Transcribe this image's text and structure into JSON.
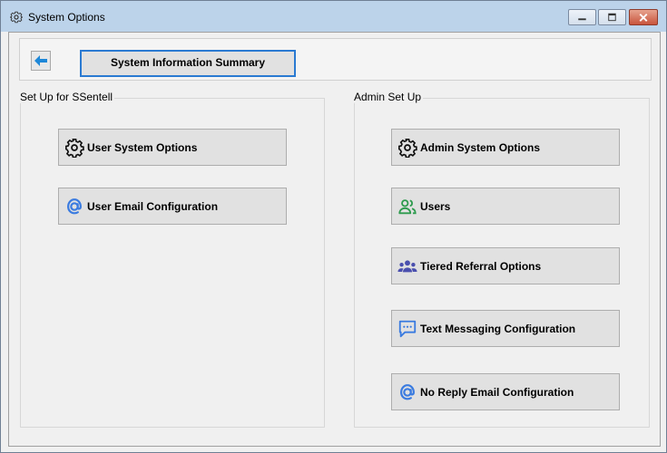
{
  "window": {
    "title": "System Options",
    "controls": {
      "minimize": "minimize",
      "maximize": "maximize",
      "close": "close"
    }
  },
  "topbar": {
    "back_icon": "arrow-left-icon",
    "summary_label": "System Information Summary"
  },
  "left_group": {
    "title": "Set Up for SSentell",
    "buttons": [
      {
        "label": "User System Options",
        "icon": "gear-icon"
      },
      {
        "label": "User Email Configuration",
        "icon": "at-sign-icon"
      }
    ]
  },
  "right_group": {
    "title": "Admin Set Up",
    "buttons": [
      {
        "label": "Admin System Options",
        "icon": "gear-icon"
      },
      {
        "label": "Users",
        "icon": "users-icon"
      },
      {
        "label": "Tiered Referral Options",
        "icon": "group-icon"
      },
      {
        "label": "Text Messaging Configuration",
        "icon": "chat-icon"
      },
      {
        "label": "No Reply Email Configuration",
        "icon": "at-sign-icon"
      }
    ]
  },
  "colors": {
    "accent_blue": "#1e88d8",
    "users_green": "#2e9b4e",
    "group_purple": "#4a4fae",
    "at_blue": "#3a7be0"
  }
}
